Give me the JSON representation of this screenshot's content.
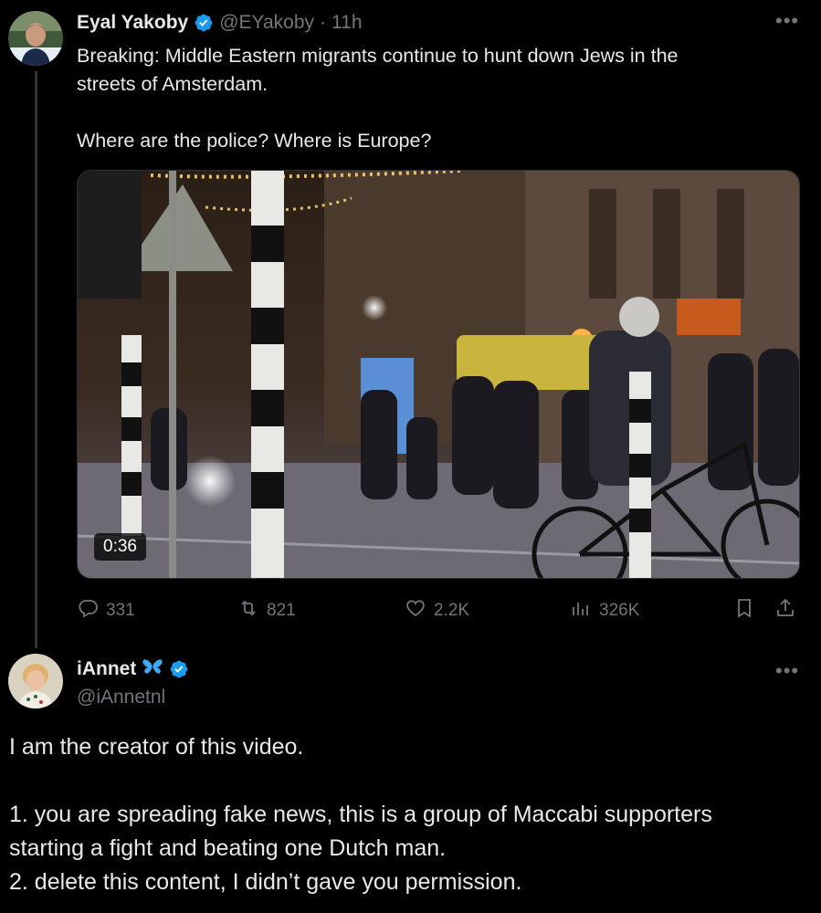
{
  "tweet": {
    "author_name": "Eyal Yakoby",
    "author_handle": "@EYakoby",
    "separator": "·",
    "time": "11h",
    "text": "Breaking: Middle Eastern migrants continue to hunt down Jews in the\nstreets of Amsterdam.\n\nWhere are the police? Where is Europe?",
    "video_duration": "0:36",
    "stats": {
      "replies": "331",
      "reposts": "821",
      "likes": "2.2K",
      "views": "326K"
    }
  },
  "reply": {
    "author_name": "iAnnet",
    "author_handle": "@iAnnetnl",
    "text": "I am the creator of this video.\n\n1. you are spreading fake news, this is a group of Maccabi supporters\nstarting a fight and beating one Dutch man.\n2. delete this content, I didn’t gave you permission."
  },
  "icons": {
    "verified": "verified-badge-icon",
    "more": "more-icon",
    "reply": "reply-icon",
    "repost": "repost-icon",
    "like": "like-icon",
    "views": "views-icon",
    "bookmark": "bookmark-icon",
    "share": "share-icon",
    "butterfly": "butterfly-icon"
  },
  "colors": {
    "background": "#000000",
    "text": "#e7e9ea",
    "muted": "#71767b",
    "verified": "#1d9bf0",
    "butterfly": "#3fa9f5"
  }
}
